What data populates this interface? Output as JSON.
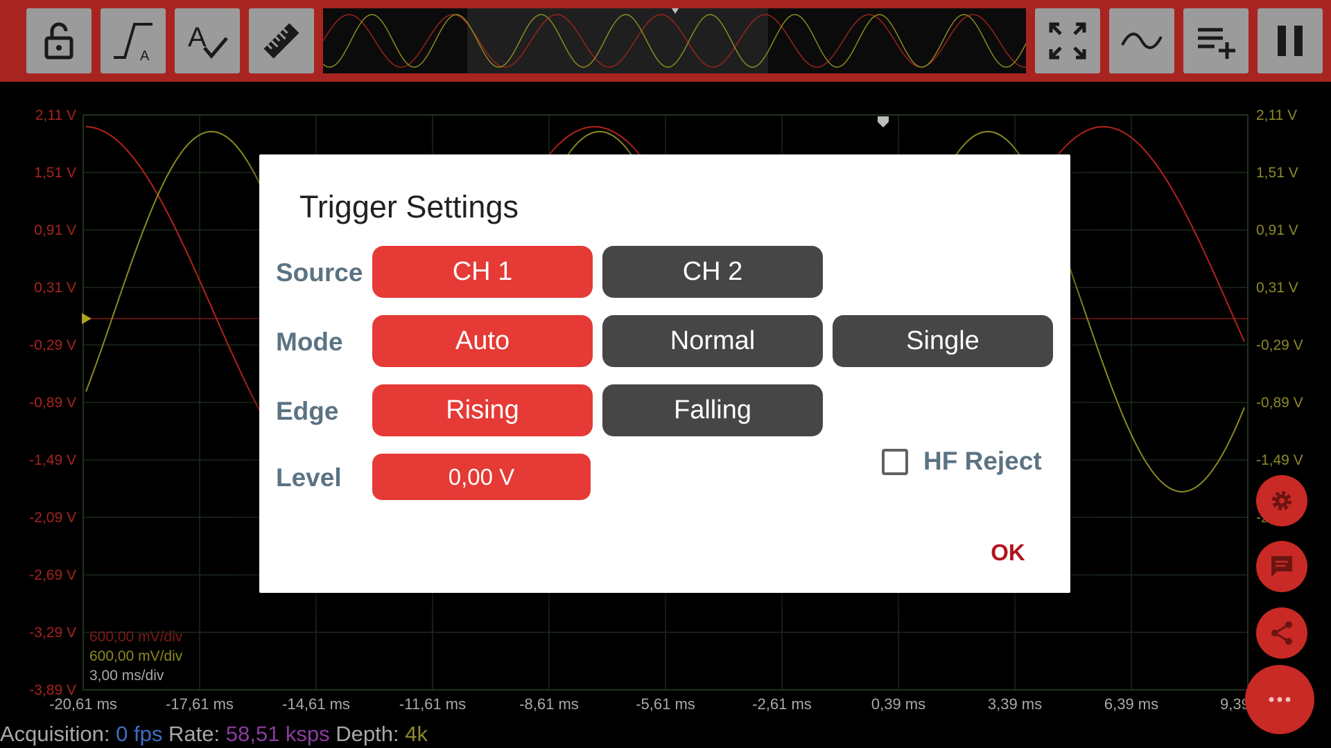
{
  "toolbar": {
    "left_buttons": [
      {
        "name": "lock-icon"
      },
      {
        "name": "trigger-icon"
      },
      {
        "name": "autoscale-icon"
      },
      {
        "name": "ruler-icon"
      }
    ],
    "right_buttons": [
      {
        "name": "fullscreen-icon"
      },
      {
        "name": "waveform-icon"
      },
      {
        "name": "add-list-icon"
      },
      {
        "name": "pause-icon"
      }
    ]
  },
  "plot": {
    "y_labels_ch1": [
      "2,11 V",
      "1,51 V",
      "0,91 V",
      "0,31 V",
      "-0,29 V",
      "-0,89 V",
      "-1,49 V",
      "-2,09 V",
      "-2,69 V",
      "-3,29 V",
      "-3,89 V"
    ],
    "y_labels_ch2": [
      "2,11 V",
      "1,51 V",
      "0,91 V",
      "0,31 V",
      "-0,29 V",
      "-0,89 V",
      "-1,49 V",
      "-2,"
    ],
    "x_labels": [
      "-20,61 ms",
      "-17,61 ms",
      "-14,61 ms",
      "-11,61 ms",
      "-8,61 ms",
      "-5,61 ms",
      "-2,61 ms",
      "0,39 ms",
      "3,39 ms",
      "6,39 ms",
      "9,39"
    ],
    "scale_ch1": "600,00 mV/div",
    "scale_ch2": "600,00 mV/div",
    "timebase": "3,00 ms/div"
  },
  "status": {
    "acq_label": "Acquisition:",
    "fps_value": "0 fps",
    "rate_label": "Rate:",
    "rate_value": "58,51 ksps",
    "depth_label": "Depth:",
    "depth_value": "4k"
  },
  "colors": {
    "ch1": "#b3231c",
    "ch2": "#8c8a22",
    "accent": "#e53a35",
    "toolbar": "#a82420"
  },
  "dialog": {
    "title": "Trigger Settings",
    "source_label": "Source",
    "source_options": [
      "CH 1",
      "CH 2"
    ],
    "source_selected": "CH 1",
    "mode_label": "Mode",
    "mode_options": [
      "Auto",
      "Normal",
      "Single"
    ],
    "mode_selected": "Auto",
    "edge_label": "Edge",
    "edge_options": [
      "Rising",
      "Falling"
    ],
    "edge_selected": "Rising",
    "level_label": "Level",
    "level_value": "0,00 V",
    "hf_reject_label": "HF Reject",
    "hf_reject_checked": false,
    "ok_label": "OK"
  },
  "fabs": [
    "gear-icon",
    "chat-icon",
    "share-icon",
    "more-icon"
  ]
}
